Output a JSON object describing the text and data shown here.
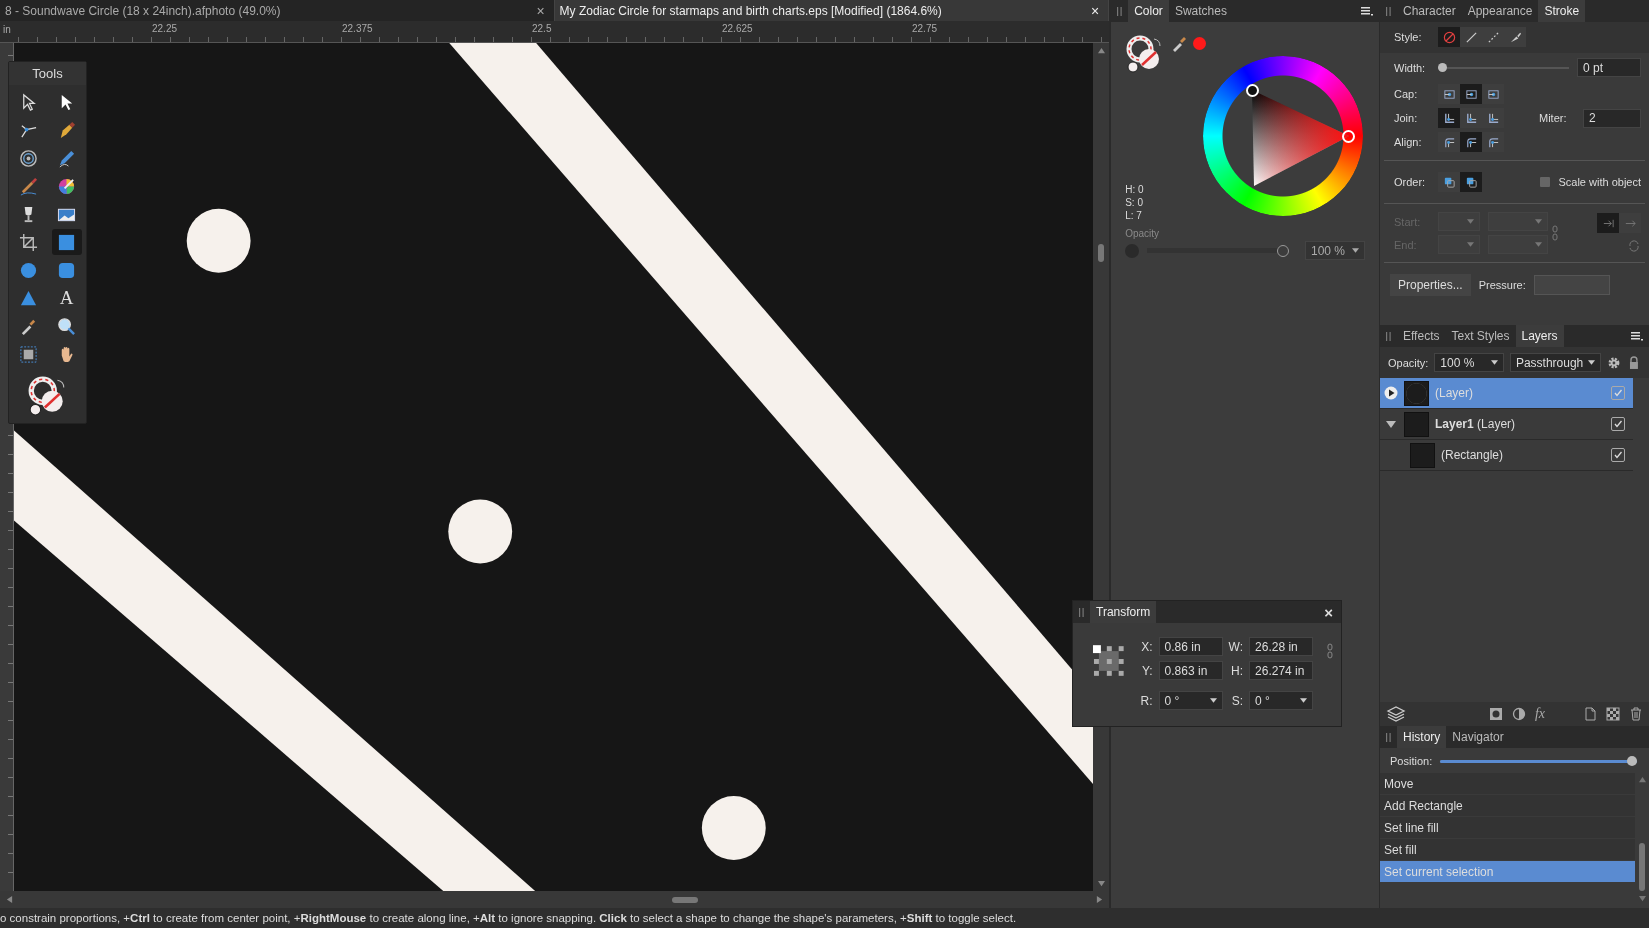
{
  "doc_tabs": [
    {
      "title": "8 - Soundwave Circle (18 x 24inch).afphoto (49.0%)",
      "close": "×",
      "selected": false
    },
    {
      "title": "My Zodiac Circle for starmaps and birth charts.eps [Modified] (1864.6%)",
      "close": "×",
      "selected": true
    }
  ],
  "ruler": {
    "unit": "in",
    "labels": [
      "22.25",
      "22.375",
      "22.5",
      "22.625",
      "22.75"
    ]
  },
  "tools": {
    "title": "Tools",
    "items": [
      {
        "kind": "move",
        "selected": false
      },
      {
        "kind": "node",
        "selected": false
      },
      {
        "kind": "corner",
        "selected": false
      },
      {
        "kind": "pen",
        "selected": false
      },
      {
        "kind": "spiral",
        "selected": false
      },
      {
        "kind": "pencil",
        "selected": false
      },
      {
        "kind": "brush",
        "selected": false
      },
      {
        "kind": "colorbrush",
        "selected": false
      },
      {
        "kind": "glass",
        "selected": false
      },
      {
        "kind": "image",
        "selected": false
      },
      {
        "kind": "crop",
        "selected": false
      },
      {
        "kind": "rectangle",
        "selected": true
      },
      {
        "kind": "ellipse",
        "selected": false
      },
      {
        "kind": "roundrect",
        "selected": false
      },
      {
        "kind": "triangle",
        "selected": false
      },
      {
        "kind": "text",
        "glyph": "A",
        "selected": false
      },
      {
        "kind": "eyedropper",
        "selected": false
      },
      {
        "kind": "zoom",
        "selected": false
      },
      {
        "kind": "artboard",
        "selected": false
      },
      {
        "kind": "hand",
        "selected": false
      }
    ]
  },
  "color_panel": {
    "tabs": [
      {
        "label": "Color",
        "selected": true
      },
      {
        "label": "Swatches",
        "selected": false
      }
    ],
    "hsl": [
      "H: 0",
      "S: 0",
      "L: 7"
    ],
    "opacity_label": "Opacity",
    "opacity": {
      "level": 1,
      "value": "100 %"
    }
  },
  "stroke_panel": {
    "tabs": [
      {
        "label": "Character",
        "selected": false
      },
      {
        "label": "Appearance",
        "selected": false
      },
      {
        "label": "Stroke",
        "selected": true
      }
    ],
    "style": {
      "label": "Style:",
      "options": [
        {
          "kind": "none",
          "selected": true
        },
        {
          "kind": "solid",
          "selected": false
        },
        {
          "kind": "dashed",
          "selected": false
        },
        {
          "kind": "brush",
          "selected": false
        }
      ]
    },
    "width": {
      "label": "Width:",
      "level": 0,
      "value": "0 pt"
    },
    "cap": {
      "label": "Cap:",
      "options": [
        {
          "selected": false
        },
        {
          "selected": true
        },
        {
          "selected": false
        }
      ]
    },
    "join": {
      "label": "Join:",
      "options": [
        {
          "selected": true
        },
        {
          "selected": false
        },
        {
          "selected": false
        }
      ]
    },
    "miter": {
      "label": "Miter:",
      "value": "2"
    },
    "align": {
      "label": "Align:",
      "options": [
        {
          "selected": false
        },
        {
          "selected": true
        },
        {
          "selected": false
        }
      ]
    },
    "order": {
      "label": "Order:",
      "options": [
        {
          "selected": false
        },
        {
          "selected": true
        }
      ]
    },
    "scale_with_object": {
      "label": "Scale with object",
      "checked": false
    },
    "start": {
      "label": "Start:",
      "disabled": true
    },
    "end": {
      "label": "End:",
      "disabled": true
    },
    "properties_button": "Properties...",
    "pressure_label": "Pressure:"
  },
  "layers_panel": {
    "tabs": [
      {
        "label": "Effects",
        "selected": false
      },
      {
        "label": "Text Styles",
        "selected": false
      },
      {
        "label": "Layers",
        "selected": true
      }
    ],
    "opacity_label": "Opacity:",
    "opacity_value": "100 %",
    "blend_mode": "Passthrough",
    "rows": [
      {
        "name": "(Layer)",
        "selected": true,
        "expanded": false,
        "visible": true
      },
      {
        "name": "**Layer1** (Layer)",
        "selected": false,
        "expanded": true,
        "visible": true,
        "children": [
          {
            "name": "(Rectangle)",
            "selected": false,
            "visible": true
          }
        ]
      }
    ],
    "fx_label": "fx"
  },
  "transform": {
    "title": "Transform",
    "close": "×",
    "fields": [
      {
        "label": "X:",
        "value": "0.86 in",
        "kind": "text"
      },
      {
        "label": "W:",
        "value": "26.28 in",
        "kind": "text"
      },
      {
        "label": "Y:",
        "value": "0.863 in",
        "kind": "text"
      },
      {
        "label": "H:",
        "value": "26.274 in",
        "kind": "text"
      },
      {
        "label": "R:",
        "value": "0 °",
        "kind": "dropdown"
      },
      {
        "label": "S:",
        "value": "0 °",
        "kind": "dropdown"
      }
    ]
  },
  "history_panel": {
    "tabs": [
      {
        "label": "History",
        "selected": true
      },
      {
        "label": "Navigator",
        "selected": false
      }
    ],
    "position_label": "Position:",
    "position": {
      "level": 1
    },
    "items": [
      {
        "label": "Move",
        "selected": false
      },
      {
        "label": "Add Rectangle",
        "selected": false
      },
      {
        "label": "Set line fill",
        "selected": false
      },
      {
        "label": "Set fill",
        "selected": false
      },
      {
        "label": "Set current selection",
        "selected": true
      }
    ]
  },
  "status_bar": "o constrain proportions, +**Ctrl** to create from center point, +**RightMouse** to create along line, +**Alt** to ignore snapping. **Click** to select a shape to change the shape's parameters, +**Shift** to toggle select."
}
